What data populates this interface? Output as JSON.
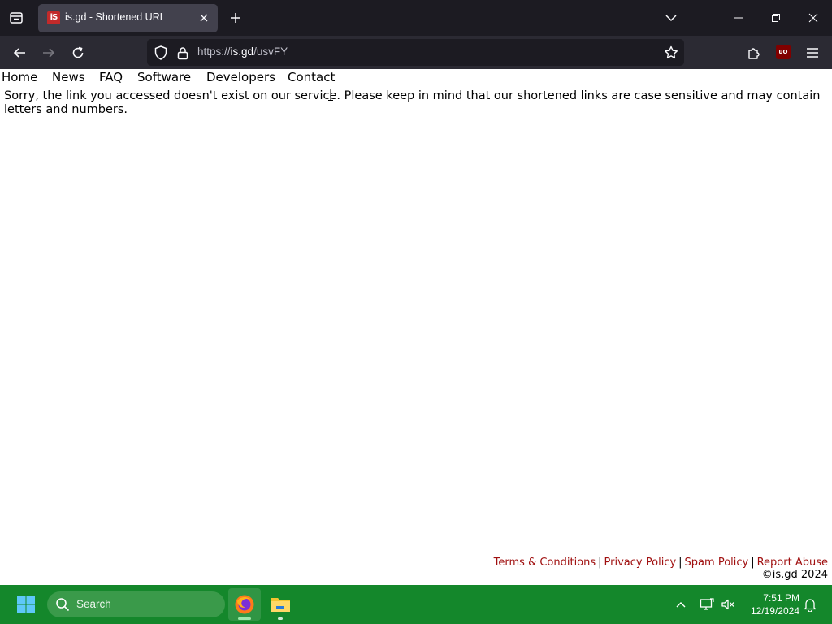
{
  "browser": {
    "tab": {
      "title": "is.gd - Shortened URL",
      "favicon_text": "iS"
    },
    "url": {
      "scheme": "https://",
      "host": "is.gd",
      "path": "/usvFY"
    },
    "extension_badge": "uO"
  },
  "site_nav": {
    "items": [
      {
        "label": "Home"
      },
      {
        "label": "News"
      },
      {
        "label": "FAQ"
      },
      {
        "label": "Software"
      },
      {
        "label": "Developers"
      },
      {
        "label": "Contact"
      }
    ]
  },
  "message": "Sorry, the link you accessed doesn't exist on our service. Please keep in mind that our shortened links are case sensitive and may contain letters and numbers.",
  "footer": {
    "links": [
      {
        "label": "Terms & Conditions"
      },
      {
        "label": "Privacy Policy"
      },
      {
        "label": "Spam Policy"
      },
      {
        "label": "Report Abuse"
      }
    ],
    "separator": "|",
    "copyright": "©is.gd 2024"
  },
  "taskbar": {
    "search_placeholder": "Search",
    "time": "7:51 PM",
    "date": "12/19/2024"
  },
  "colors": {
    "tabbar_bg": "#1c1b22",
    "navbar_bg": "#2b2a33",
    "link_red": "#a01010",
    "nav_border": "#b00000",
    "taskbar_green": "#14872b"
  }
}
